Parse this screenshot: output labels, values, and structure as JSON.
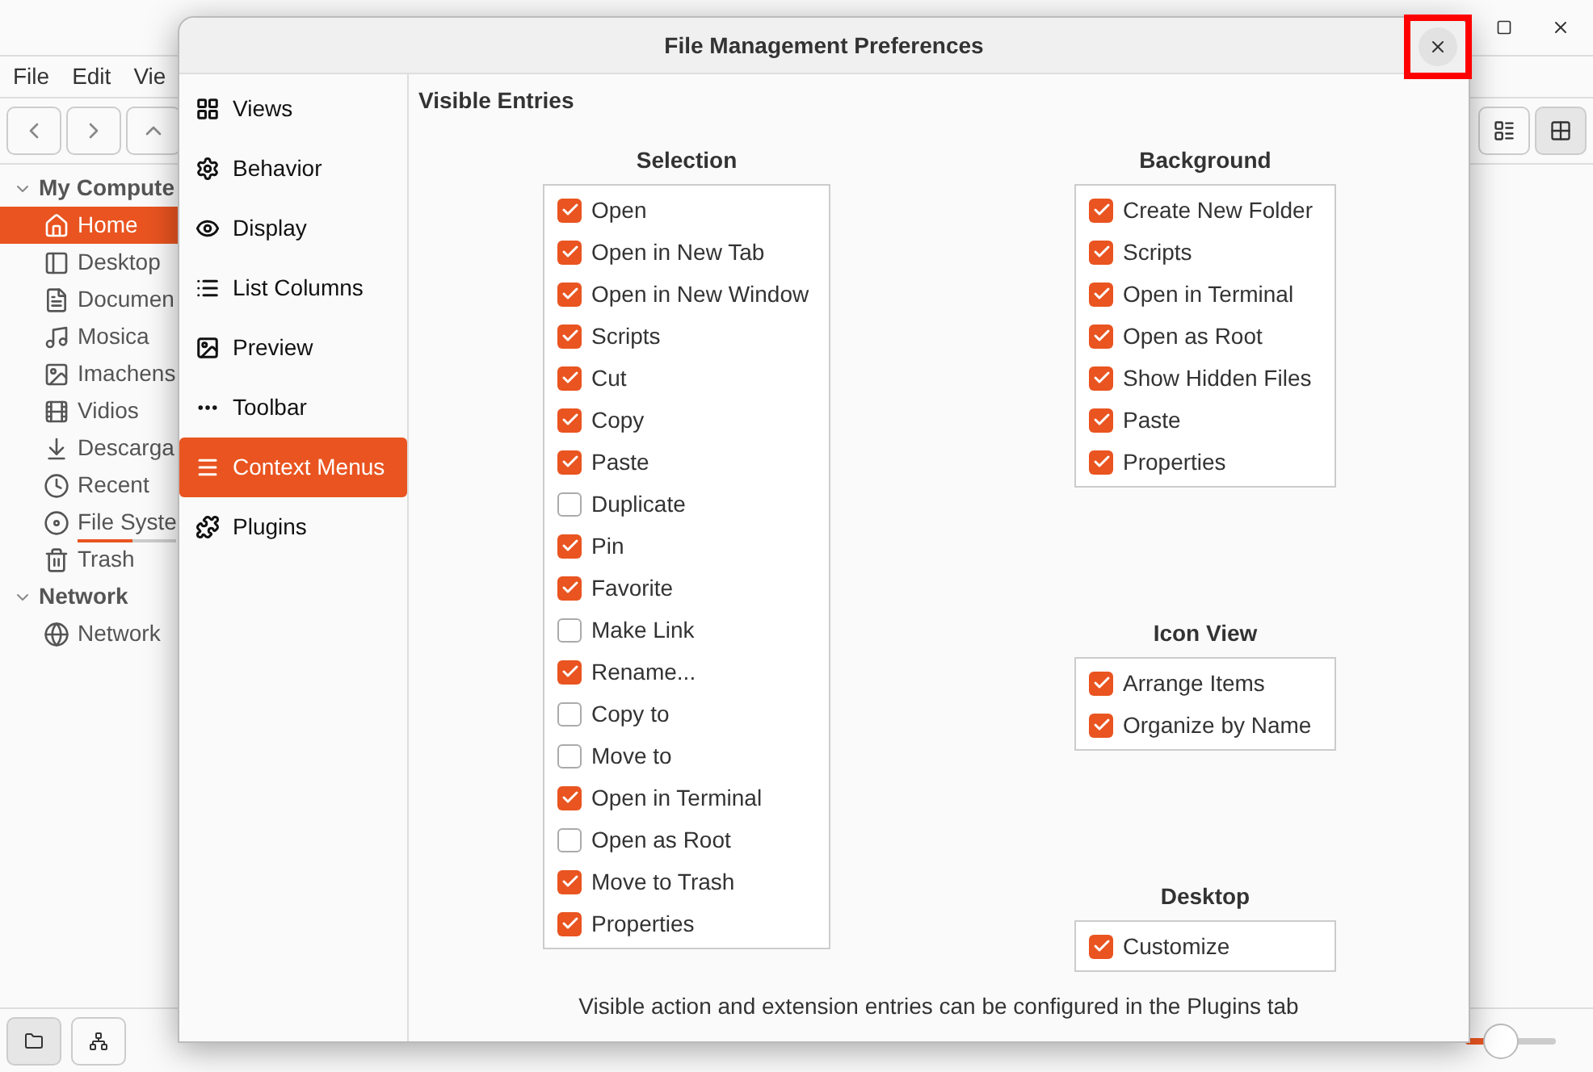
{
  "background_window": {
    "menu": [
      "File",
      "Edit",
      "Vie"
    ],
    "sidebar": [
      {
        "label": "My Compute",
        "expanded": true,
        "children": [
          {
            "label": "Home",
            "selected": true
          },
          {
            "label": "Desktop",
            "selected": false
          },
          {
            "label": "Documen",
            "selected": false
          },
          {
            "label": "Mosica",
            "selected": false
          },
          {
            "label": "Imachens",
            "selected": false
          },
          {
            "label": "Vidios",
            "selected": false
          },
          {
            "label": "Descarga",
            "selected": false
          },
          {
            "label": "Recent",
            "selected": false
          },
          {
            "label": "File Syste",
            "selected": false,
            "level": 0.55
          },
          {
            "label": "Trash",
            "selected": false
          }
        ]
      },
      {
        "label": "Network",
        "expanded": true,
        "children": [
          {
            "label": "Network",
            "selected": false
          }
        ]
      }
    ],
    "view_buttons": [
      {
        "kind": "list",
        "selected": false
      },
      {
        "kind": "icons",
        "selected": true
      }
    ],
    "zoom_slider": {
      "level": 0.4
    }
  },
  "dialog": {
    "title": "File Management Preferences",
    "close_highlighted": true,
    "nav": [
      {
        "label": "Views",
        "selected": false
      },
      {
        "label": "Behavior",
        "selected": false
      },
      {
        "label": "Display",
        "selected": false
      },
      {
        "label": "List Columns",
        "selected": false
      },
      {
        "label": "Preview",
        "selected": false
      },
      {
        "label": "Toolbar",
        "selected": false
      },
      {
        "label": "Context Menus",
        "selected": true
      },
      {
        "label": "Plugins",
        "selected": false
      }
    ],
    "heading": "Visible Entries",
    "selection": {
      "title": "Selection",
      "entries": [
        {
          "label": "Open",
          "checked": true
        },
        {
          "label": "Open in New Tab",
          "checked": true
        },
        {
          "label": "Open in New Window",
          "checked": true
        },
        {
          "label": "Scripts",
          "checked": true
        },
        {
          "label": "Cut",
          "checked": true
        },
        {
          "label": "Copy",
          "checked": true
        },
        {
          "label": "Paste",
          "checked": true
        },
        {
          "label": "Duplicate",
          "checked": false
        },
        {
          "label": "Pin",
          "checked": true
        },
        {
          "label": "Favorite",
          "checked": true
        },
        {
          "label": "Make Link",
          "checked": false
        },
        {
          "label": "Rename...",
          "checked": true
        },
        {
          "label": "Copy to",
          "checked": false
        },
        {
          "label": "Move to",
          "checked": false
        },
        {
          "label": "Open in Terminal",
          "checked": true
        },
        {
          "label": "Open as Root",
          "checked": false
        },
        {
          "label": "Move to Trash",
          "checked": true
        },
        {
          "label": "Properties",
          "checked": true
        }
      ]
    },
    "background": {
      "title": "Background",
      "entries": [
        {
          "label": "Create New Folder",
          "checked": true
        },
        {
          "label": "Scripts",
          "checked": true
        },
        {
          "label": "Open in Terminal",
          "checked": true
        },
        {
          "label": "Open as Root",
          "checked": true
        },
        {
          "label": "Show Hidden Files",
          "checked": true
        },
        {
          "label": "Paste",
          "checked": true
        },
        {
          "label": "Properties",
          "checked": true
        }
      ]
    },
    "icon_view": {
      "title": "Icon View",
      "entries": [
        {
          "label": "Arrange Items",
          "checked": true
        },
        {
          "label": "Organize by Name",
          "checked": true
        }
      ]
    },
    "desktop": {
      "title": "Desktop",
      "entries": [
        {
          "label": "Customize",
          "checked": true
        }
      ]
    },
    "footer": "Visible action and extension entries can be configured in the Plugins tab"
  }
}
